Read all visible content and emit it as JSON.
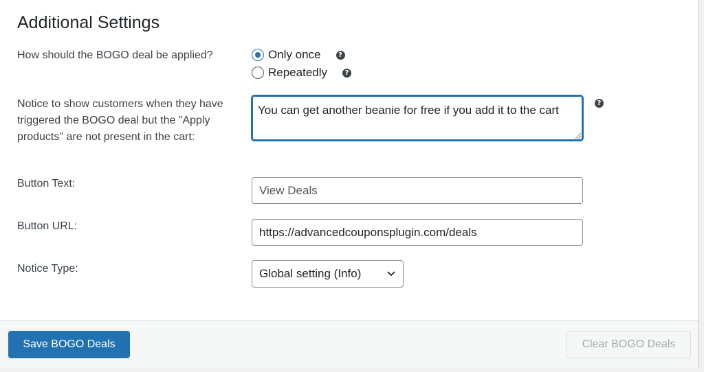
{
  "section": {
    "title": "Additional Settings"
  },
  "apply_mode": {
    "label": "How should the BOGO deal be applied?",
    "options": [
      {
        "label": "Only once",
        "selected": true
      },
      {
        "label": "Repeatedly",
        "selected": false
      }
    ]
  },
  "notice": {
    "label": "Notice to show customers when they have triggered the BOGO deal but the \"Apply products\" are not present in the cart:",
    "value": "You can get another beanie for free if you add it to the cart"
  },
  "button_text": {
    "label": "Button Text:",
    "placeholder": "View Deals",
    "value": ""
  },
  "button_url": {
    "label": "Button URL:",
    "value": "https://advancedcouponsplugin.com/deals"
  },
  "notice_type": {
    "label": "Notice Type:",
    "selected": "Global setting (Info)"
  },
  "help_icon": "?",
  "footer": {
    "save_label": "Save BOGO Deals",
    "clear_label": "Clear BOGO Deals"
  },
  "colors": {
    "primary": "#2271b1",
    "footer_bg": "#f6f7f7"
  }
}
